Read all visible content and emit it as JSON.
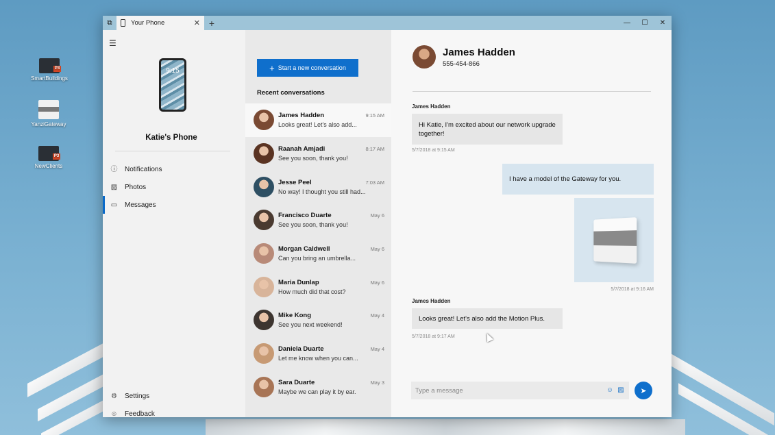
{
  "desktop": {
    "icons": [
      {
        "label": "SmartBuildings"
      },
      {
        "label": "YanziGateway"
      },
      {
        "label": "NewClients"
      }
    ],
    "ppt_badge": "P3"
  },
  "window": {
    "tab_title": "Your Phone",
    "tab_close": "✕",
    "new_tab": "+",
    "minimize": "—",
    "maximize": "☐",
    "close": "✕"
  },
  "nav": {
    "hamburger": "☰",
    "phone_time": "9:15",
    "phone_name": "Katie's Phone",
    "items": [
      {
        "label": "Notifications"
      },
      {
        "label": "Photos"
      },
      {
        "label": "Messages"
      }
    ],
    "bottom": [
      {
        "label": "Settings"
      },
      {
        "label": "Feedback"
      }
    ]
  },
  "conversations": {
    "new_button": "Start a new conversation",
    "new_plus": "+",
    "recent_title": "Recent conversations",
    "list": [
      {
        "name": "James Hadden",
        "time": "9:15 AM",
        "preview": "Looks great! Let's also add...",
        "avatar_color": "#7a4a33"
      },
      {
        "name": "Raanah Amjadi",
        "time": "8:17 AM",
        "preview": "See you soon, thank you!",
        "avatar_color": "#5a3322"
      },
      {
        "name": "Jesse Peel",
        "time": "7:03 AM",
        "preview": "No way! I thought you still had...",
        "avatar_color": "#2e4f63"
      },
      {
        "name": "Francisco Duarte",
        "time": "May 6",
        "preview": "See you soon, thank you!",
        "avatar_color": "#4a3a30"
      },
      {
        "name": "Morgan Caldwell",
        "time": "May 6",
        "preview": "Can you bring an umbrella...",
        "avatar_color": "#b88a78"
      },
      {
        "name": "Maria Dunlap",
        "time": "May 6",
        "preview": "How much did that cost?",
        "avatar_color": "#d8b49a"
      },
      {
        "name": "Mike Kong",
        "time": "May 4",
        "preview": "See you next weekend!",
        "avatar_color": "#3d3530"
      },
      {
        "name": "Daniela Duarte",
        "time": "May 4",
        "preview": "Let me know when you can...",
        "avatar_color": "#c79a74"
      },
      {
        "name": "Sara Duarte",
        "time": "May 3",
        "preview": "Maybe we can play it by ear.",
        "avatar_color": "#a87556"
      }
    ]
  },
  "chat": {
    "name": "James Hadden",
    "phone": "555-454-866",
    "avatar_color": "#7a4a33",
    "messages": [
      {
        "sender": "James Hadden",
        "text": "Hi Katie, I'm excited about our network upgrade together!",
        "stamp": "5/7/2018 at 9:15 AM"
      },
      {
        "text": "I have a model of the Gateway for you.",
        "stamp": "5/7/2018 at 9:16 AM"
      },
      {
        "sender": "James Hadden",
        "text": "Looks great! Let's also add the Motion Plus.",
        "stamp": "5/7/2018 at 9:17 AM"
      }
    ],
    "compose_placeholder": "Type a message",
    "send_icon": "➤"
  }
}
